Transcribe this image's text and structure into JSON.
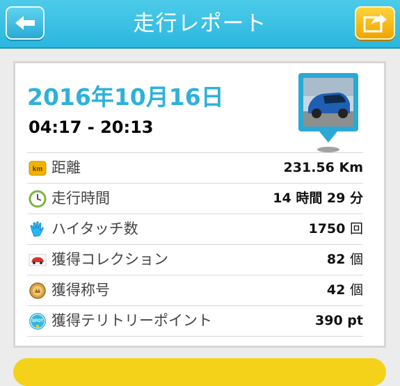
{
  "header": {
    "title": "走行レポート",
    "back_icon": "arrow-left-icon",
    "share_icon": "share-icon"
  },
  "report": {
    "date": "2016年10月16日",
    "time_range": "04:17 - 20:13"
  },
  "stats": [
    {
      "icon": "km-badge-icon",
      "label": "距離",
      "value": "231.56 Km",
      "unit": ""
    },
    {
      "icon": "clock-icon",
      "label": "走行時間",
      "value": "14 時間 29 分",
      "unit": ""
    },
    {
      "icon": "high-five-hand-icon",
      "label": "ハイタッチ数",
      "value": "1750",
      "unit": "回"
    },
    {
      "icon": "car-collection-icon",
      "label": "獲得コレクション",
      "value": "82",
      "unit": "個"
    },
    {
      "icon": "title-medal-icon",
      "label": "獲得称号",
      "value": "42",
      "unit": "個"
    },
    {
      "icon": "spot-icon",
      "label": "獲得テリトリーポイント",
      "value": "390 pt",
      "unit": ""
    }
  ],
  "colors": {
    "header": "#2bb7df",
    "accent": "#2fb1d8",
    "share_button": "#f0a500",
    "bottom_button": "#f5d21a"
  }
}
